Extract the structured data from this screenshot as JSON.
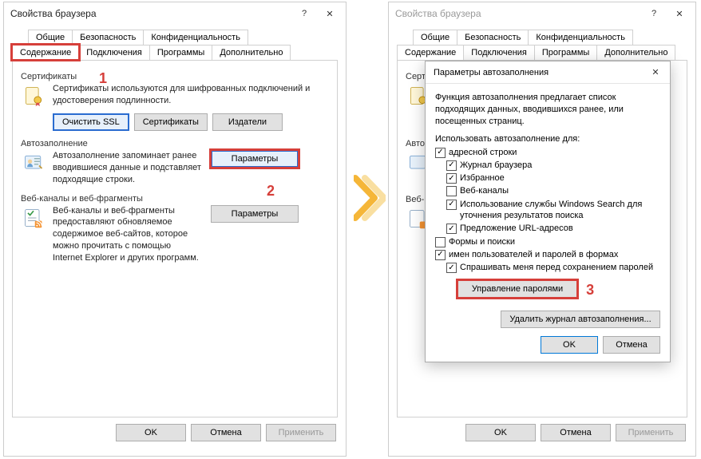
{
  "left": {
    "title": "Свойства браузера",
    "tabs_top": [
      "Общие",
      "Безопасность",
      "Конфиденциальность"
    ],
    "tabs_bottom": [
      "Содержание",
      "Подключения",
      "Программы",
      "Дополнительно"
    ],
    "active_tab": "Содержание",
    "cert": {
      "label": "Сертификаты",
      "desc": "Сертификаты используются для шифрованных подключений и удостоверения подлинности.",
      "clear_ssl": "Очистить SSL",
      "certs": "Сертификаты",
      "publishers": "Издатели"
    },
    "auto": {
      "label": "Автозаполнение",
      "desc": "Автозаполнение запоминает ранее вводившиеся данные и подставляет подходящие строки.",
      "params": "Параметры"
    },
    "feeds": {
      "label": "Веб-каналы и веб-фрагменты",
      "desc": "Веб-каналы и веб-фрагменты предоставляют обновляемое содержимое веб-сайтов, которое можно прочитать с помощью Internet Explorer и других программ.",
      "params": "Параметры"
    },
    "footer": {
      "ok": "OK",
      "cancel": "Отмена",
      "apply": "Применить"
    },
    "markers": {
      "one": "1",
      "two": "2"
    }
  },
  "right": {
    "title": "Свойства браузера",
    "tabs_top": [
      "Общие",
      "Безопасность",
      "Конфиденциальность"
    ],
    "tabs_bottom": [
      "Содержание",
      "Подключения",
      "Программы",
      "Дополнительно"
    ],
    "cert_label": "Серти",
    "auto_label": "Автоз",
    "feeds_label": "Веб-к",
    "footer": {
      "ok": "OK",
      "cancel": "Отмена",
      "apply": "Применить"
    }
  },
  "dialog": {
    "title": "Параметры автозаполнения",
    "desc": "Функция автозаполнения предлагает список подходящих данных, вводившихся ранее, или посещенных страниц.",
    "use_label": "Использовать автозаполнение для:",
    "items": [
      {
        "label": "адресной строки",
        "checked": true,
        "indent": 0
      },
      {
        "label": "Журнал браузера",
        "checked": true,
        "indent": 1
      },
      {
        "label": "Избранное",
        "checked": true,
        "indent": 1
      },
      {
        "label": "Веб-каналы",
        "checked": false,
        "indent": 1
      },
      {
        "label": "Использование службы Windows Search для уточнения результатов поиска",
        "checked": true,
        "indent": 1
      },
      {
        "label": "Предложение URL-адресов",
        "checked": true,
        "indent": 1
      },
      {
        "label": "Формы и поиски",
        "checked": false,
        "indent": 0
      },
      {
        "label": "имен пользователей и паролей в формах",
        "checked": true,
        "indent": 0
      },
      {
        "label": "Спрашивать меня перед сохранением паролей",
        "checked": true,
        "indent": 1
      }
    ],
    "manage_passwords": "Управление паролями",
    "delete_history": "Удалить журнал автозаполнения...",
    "ok": "OK",
    "cancel": "Отмена",
    "marker_three": "3"
  }
}
